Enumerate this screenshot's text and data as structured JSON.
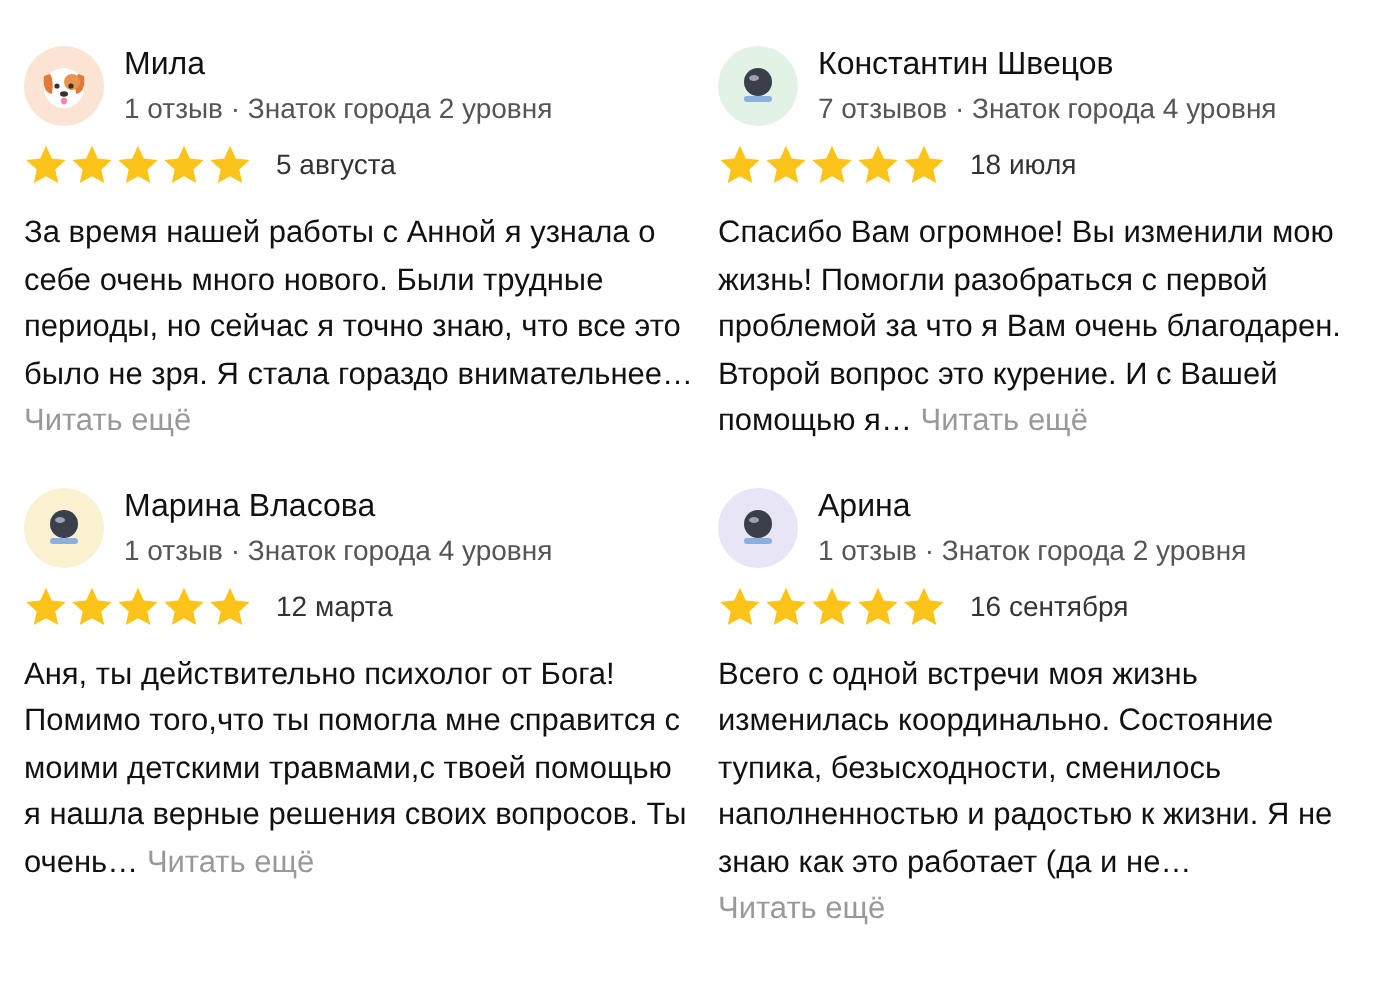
{
  "reviews": [
    {
      "name": "Мила",
      "meta": "1 отзыв · Знаток города 2 уровня",
      "avatar": {
        "kind": "dog",
        "color": "#fbe4d4"
      },
      "stars": 5,
      "date": "5 августа",
      "text": "За время нашей работы с Анной я узнала о себе очень много нового. Были трудные периоды, но сейчас я точно знаю, что все это было не зря. Я стала гораздо внимательнее…",
      "more": "Читать ещё"
    },
    {
      "name": "Константин Швецов",
      "meta": "7 отзывов · Знаток города 4 уровня",
      "avatar": {
        "kind": "robot",
        "color": "#e2f2e4"
      },
      "stars": 5,
      "date": "18 июля",
      "text": "Спасибо Вам огромное! Вы изменили мою жизнь! Помогли разобраться с первой проблемой за что я Вам очень благодарен. Второй вопрос это курение. И с Вашей помощью я…",
      "more": "Читать ещё"
    },
    {
      "name": "Марина Власова",
      "meta": "1 отзыв · Знаток города 4 уровня",
      "avatar": {
        "kind": "robot",
        "color": "#fbf0cf"
      },
      "stars": 5,
      "date": "12 марта",
      "text": "Аня, ты действительно психолог от Бога! Помимо того,что ты помогла мне справится с моими детскими травмами,с твоей помощью я нашла верные решения своих вопросов. Ты очень…",
      "more": "Читать ещё"
    },
    {
      "name": "Арина",
      "meta": "1 отзыв · Знаток города 2 уровня",
      "avatar": {
        "kind": "robot",
        "color": "#e8e5f6"
      },
      "stars": 5,
      "date": "16 сентября",
      "text": "Всего с одной встречи моя жизнь изменилась координально. Состояние тупика, безысходности, сменилось наполненностью и радостью к жизни. Я не знаю как это работает (да и не…",
      "more": "Читать ещё"
    }
  ]
}
